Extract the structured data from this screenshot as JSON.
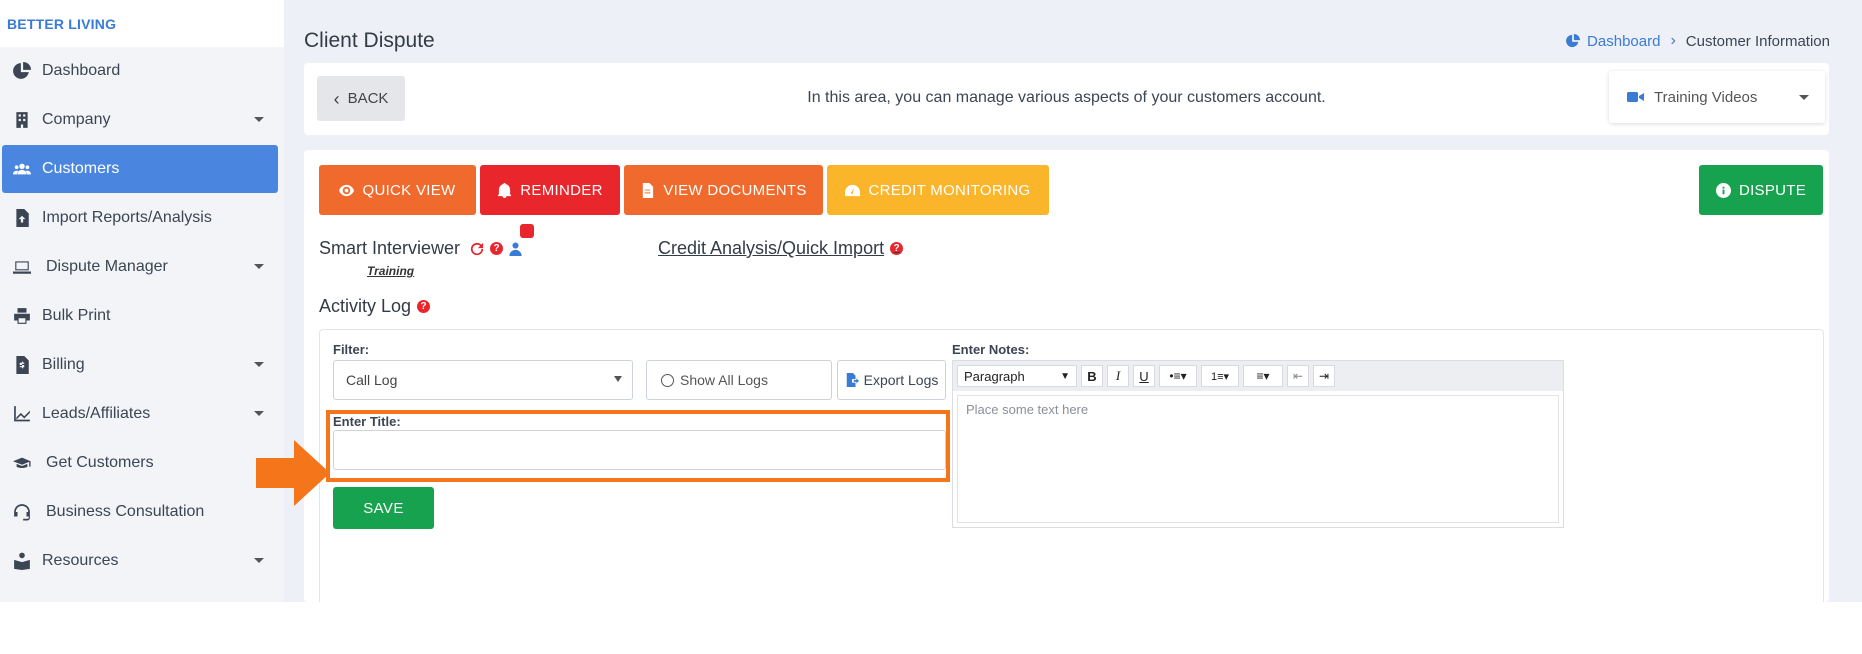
{
  "brand": "BETTER LIVING",
  "sidebar": {
    "items": [
      {
        "label": "Dashboard",
        "icon": "chart-pie-icon",
        "has_caret": false,
        "active": false
      },
      {
        "label": "Company",
        "icon": "building-icon",
        "has_caret": true,
        "active": false
      },
      {
        "label": "Customers",
        "icon": "users-icon",
        "has_caret": false,
        "active": true
      },
      {
        "label": "Import Reports/Analysis",
        "icon": "file-upload-icon",
        "has_caret": false,
        "active": false
      },
      {
        "label": "Dispute Manager",
        "icon": "laptop-icon",
        "has_caret": true,
        "active": false
      },
      {
        "label": "Bulk Print",
        "icon": "printer-icon",
        "has_caret": false,
        "active": false
      },
      {
        "label": "Billing",
        "icon": "invoice-icon",
        "has_caret": true,
        "active": false
      },
      {
        "label": "Leads/Affiliates",
        "icon": "line-chart-icon",
        "has_caret": true,
        "active": false
      },
      {
        "label": "Get Customers",
        "icon": "graduation-cap-icon",
        "has_caret": false,
        "active": false
      },
      {
        "label": "Business Consultation",
        "icon": "headset-icon",
        "has_caret": false,
        "active": false
      },
      {
        "label": "Resources",
        "icon": "book-reader-icon",
        "has_caret": true,
        "active": false
      }
    ]
  },
  "header": {
    "title": "Client Dispute",
    "breadcrumb": {
      "home": "Dashboard",
      "current": "Customer Information"
    }
  },
  "topbar": {
    "back_label": "BACK",
    "info_text": "In this area, you can manage various aspects of your customers account.",
    "training_videos_label": "Training Videos"
  },
  "actions": {
    "quick_view": "QUICK VIEW",
    "reminder": "REMINDER",
    "view_documents": "VIEW DOCUMENTS",
    "credit_monitoring": "CREDIT MONITORING",
    "dispute": "DISPUTE"
  },
  "smart_interviewer": {
    "label": "Smart Interviewer",
    "training_label": "Training"
  },
  "credit_analysis": {
    "label": "Credit Analysis/Quick Import"
  },
  "activity_log": {
    "title": "Activity Log",
    "filter_label": "Filter:",
    "filter_value": "Call Log",
    "show_all_label": "Show All Logs",
    "export_label": "Export Logs",
    "enter_title_label": "Enter Title:",
    "title_value": "",
    "save_label": "SAVE",
    "notes_label": "Enter Notes:",
    "editor": {
      "paragraph_label": "Paragraph",
      "bold": "B",
      "italic": "I",
      "underline": "U",
      "placeholder": "Place some text here"
    }
  },
  "colors": {
    "orange": "#f06a2e",
    "red": "#e8262b",
    "yellow": "#fbb52a",
    "green": "#17a24f",
    "blue": "#4a86e0",
    "highlight": "#f5751b"
  }
}
